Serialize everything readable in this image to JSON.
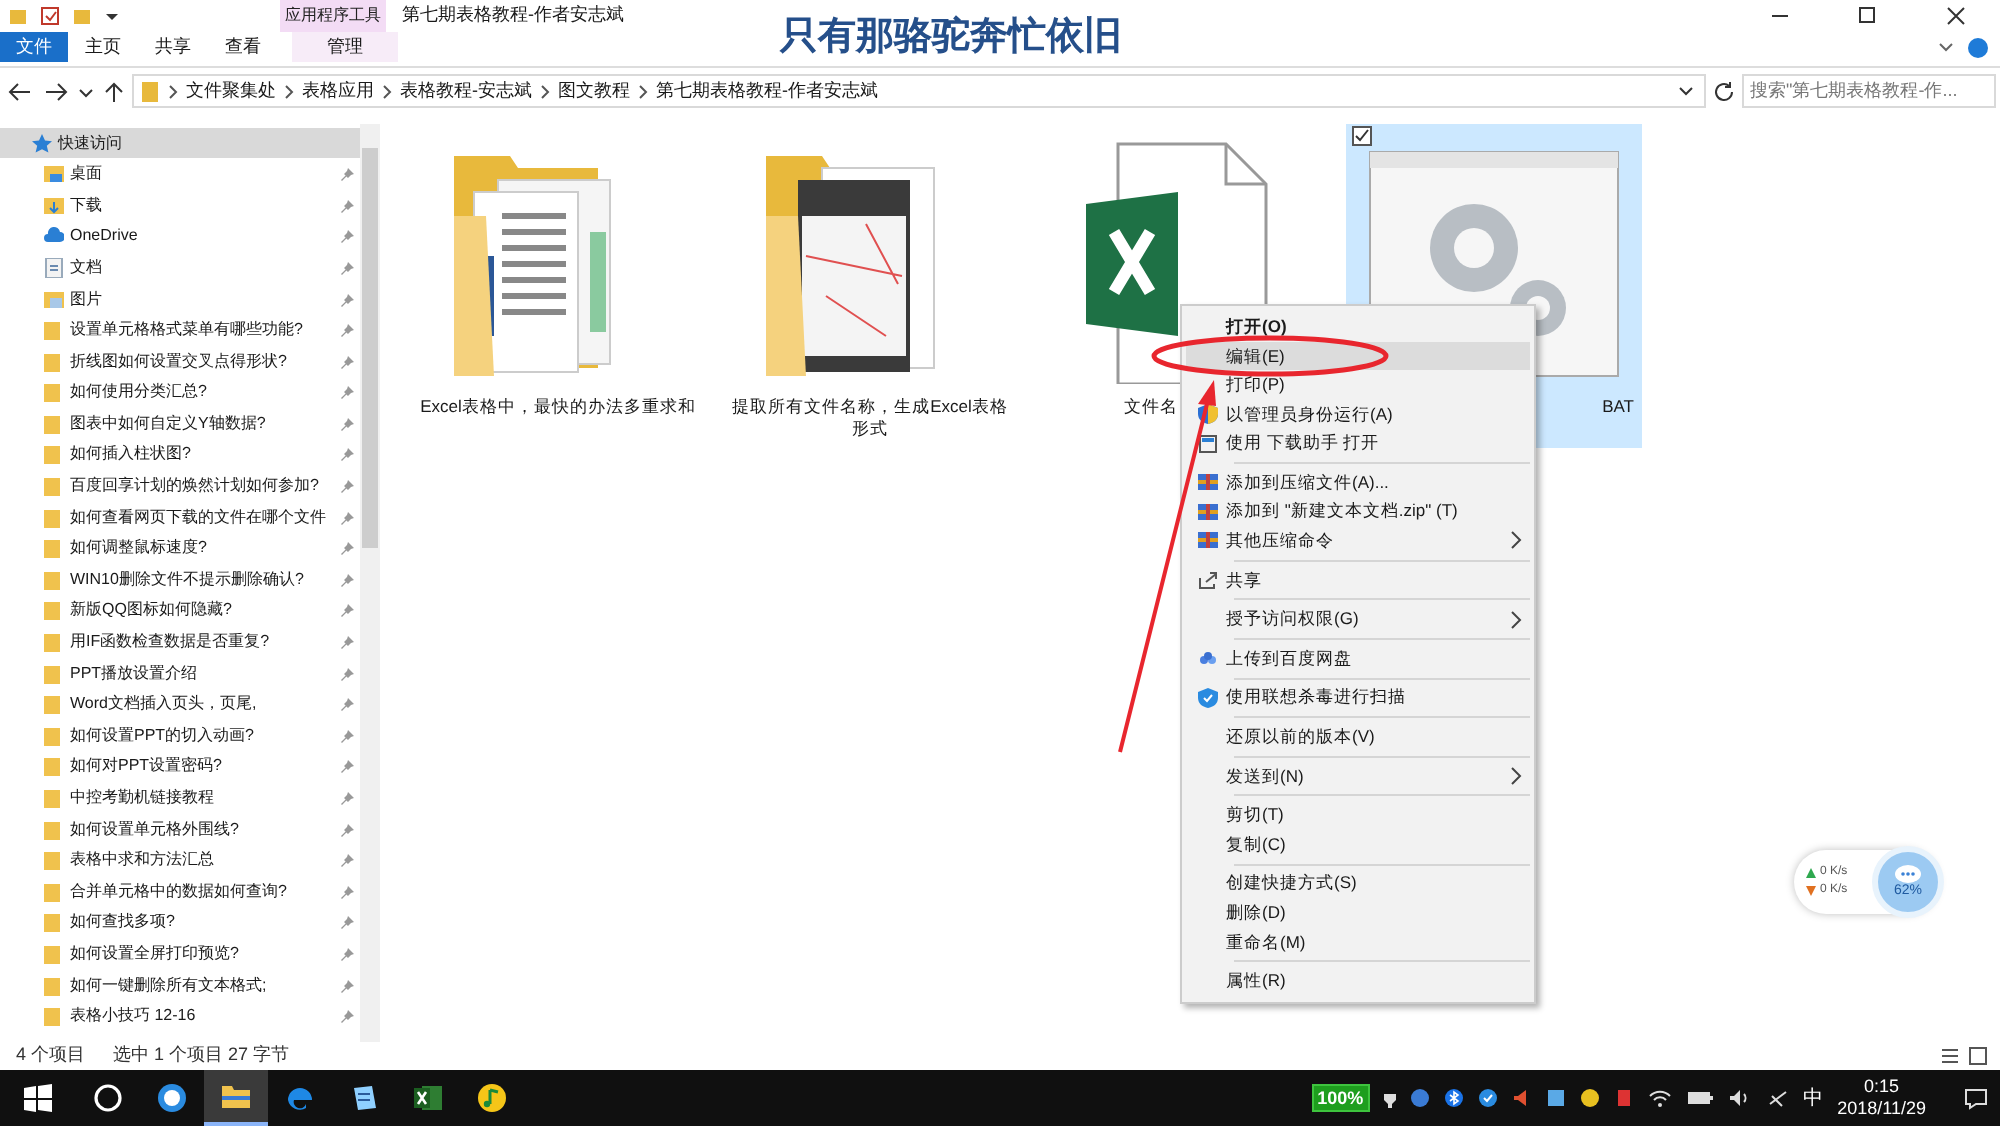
{
  "window": {
    "title": "第七期表格教程-作者安志斌",
    "context_tab_group": "应用程序工具"
  },
  "caption": "只有那骆驼奔忙依旧",
  "ribbon_tabs": [
    {
      "label": "文件",
      "kind": "file",
      "selected": false
    },
    {
      "label": "主页",
      "kind": "tab",
      "selected": false
    },
    {
      "label": "共享",
      "kind": "tab",
      "selected": false
    },
    {
      "label": "查看",
      "kind": "tab",
      "selected": false
    },
    {
      "label": "管理",
      "kind": "context",
      "selected": false
    }
  ],
  "address": {
    "segments": [
      "文件聚集处",
      "表格应用",
      "表格教程-安志斌",
      "图文教程",
      "第七期表格教程-作者安志斌"
    ]
  },
  "search": {
    "placeholder": "搜索\"第七期表格教程-作..."
  },
  "sidebar": {
    "items": [
      {
        "label": "快速访问",
        "pinned": false,
        "selected": true
      },
      {
        "label": "桌面",
        "pinned": true,
        "selected": false
      },
      {
        "label": "下载",
        "pinned": true,
        "selected": false
      },
      {
        "label": "OneDrive",
        "pinned": true,
        "selected": false
      },
      {
        "label": "文档",
        "pinned": true,
        "selected": false
      },
      {
        "label": "图片",
        "pinned": true,
        "selected": false
      },
      {
        "label": "设置单元格格式菜单有哪些功能?",
        "pinned": true,
        "selected": false
      },
      {
        "label": "折线图如何设置交叉点得形状?",
        "pinned": true,
        "selected": false
      },
      {
        "label": "如何使用分类汇总?",
        "pinned": true,
        "selected": false
      },
      {
        "label": "图表中如何自定义Y轴数据?",
        "pinned": true,
        "selected": false
      },
      {
        "label": "如何插入柱状图?",
        "pinned": true,
        "selected": false
      },
      {
        "label": "百度回享计划的焕然计划如何参加?",
        "pinned": true,
        "selected": false
      },
      {
        "label": "如何查看网页下载的文件在哪个文件",
        "pinned": true,
        "selected": false
      },
      {
        "label": "如何调整鼠标速度?",
        "pinned": true,
        "selected": false
      },
      {
        "label": "WIN10删除文件不提示删除确认?",
        "pinned": true,
        "selected": false
      },
      {
        "label": "新版QQ图标如何隐藏?",
        "pinned": true,
        "selected": false
      },
      {
        "label": "用IF函数检查数据是否重复?",
        "pinned": true,
        "selected": false
      },
      {
        "label": "PPT播放设置介绍",
        "pinned": true,
        "selected": false
      },
      {
        "label": "Word文档插入页头，页尾,",
        "pinned": true,
        "selected": false
      },
      {
        "label": "如何设置PPT的切入动画?",
        "pinned": true,
        "selected": false
      },
      {
        "label": "如何对PPT设置密码?",
        "pinned": true,
        "selected": false
      },
      {
        "label": "中控考勤机链接教程",
        "pinned": true,
        "selected": false
      },
      {
        "label": "如何设置单元格外围线?",
        "pinned": true,
        "selected": false
      },
      {
        "label": "表格中求和方法汇总",
        "pinned": true,
        "selected": false
      },
      {
        "label": "合并单元格中的数据如何查询?",
        "pinned": true,
        "selected": false
      },
      {
        "label": "如何查找多项?",
        "pinned": true,
        "selected": false
      },
      {
        "label": "如何设置全屏打印预览?",
        "pinned": true,
        "selected": false
      },
      {
        "label": "如何一键删除所有文本格式;",
        "pinned": true,
        "selected": false
      },
      {
        "label": "表格小技巧 12-16",
        "pinned": true,
        "selected": false
      }
    ]
  },
  "files": [
    {
      "name": "Excel表格中，最快的办法多重求和",
      "selected": false,
      "checked": false
    },
    {
      "name": "提取所有文件名称，生成Excel表格形式",
      "selected": false,
      "checked": false
    },
    {
      "name": "文件名",
      "selected": false,
      "checked": false
    },
    {
      "name": "BAT",
      "selected": true,
      "checked": true
    }
  ],
  "context_menu": {
    "items": [
      {
        "kind": "item",
        "label": "打开(O)",
        "bold": true,
        "selected": false,
        "submenu": false
      },
      {
        "kind": "item",
        "label": "编辑(E)",
        "bold": false,
        "selected": true,
        "submenu": false
      },
      {
        "kind": "item",
        "label": "打印(P)",
        "bold": false,
        "selected": false,
        "submenu": false
      },
      {
        "kind": "item",
        "label": "以管理员身份运行(A)",
        "bold": false,
        "selected": false,
        "submenu": false
      },
      {
        "kind": "item",
        "label": "使用 下载助手 打开",
        "bold": false,
        "selected": false,
        "submenu": false
      },
      {
        "kind": "separator"
      },
      {
        "kind": "item",
        "label": "添加到压缩文件(A)...",
        "bold": false,
        "selected": false,
        "submenu": false
      },
      {
        "kind": "item",
        "label": "添加到 \"新建文本文档.zip\" (T)",
        "bold": false,
        "selected": false,
        "submenu": false
      },
      {
        "kind": "item",
        "label": "其他压缩命令",
        "bold": false,
        "selected": false,
        "submenu": true
      },
      {
        "kind": "separator"
      },
      {
        "kind": "item",
        "label": "共享",
        "bold": false,
        "selected": false,
        "submenu": false
      },
      {
        "kind": "separator"
      },
      {
        "kind": "item",
        "label": "授予访问权限(G)",
        "bold": false,
        "selected": false,
        "submenu": true
      },
      {
        "kind": "separator"
      },
      {
        "kind": "item",
        "label": "上传到百度网盘",
        "bold": false,
        "selected": false,
        "submenu": false
      },
      {
        "kind": "separator"
      },
      {
        "kind": "item",
        "label": "使用联想杀毒进行扫描",
        "bold": false,
        "selected": false,
        "submenu": false
      },
      {
        "kind": "separator"
      },
      {
        "kind": "item",
        "label": "还原以前的版本(V)",
        "bold": false,
        "selected": false,
        "submenu": false
      },
      {
        "kind": "separator"
      },
      {
        "kind": "item",
        "label": "发送到(N)",
        "bold": false,
        "selected": false,
        "submenu": true
      },
      {
        "kind": "separator"
      },
      {
        "kind": "item",
        "label": "剪切(T)",
        "bold": false,
        "selected": false,
        "submenu": false
      },
      {
        "kind": "item",
        "label": "复制(C)",
        "bold": false,
        "selected": false,
        "submenu": false
      },
      {
        "kind": "separator"
      },
      {
        "kind": "item",
        "label": "创建快捷方式(S)",
        "bold": false,
        "selected": false,
        "submenu": false
      },
      {
        "kind": "item",
        "label": "删除(D)",
        "bold": false,
        "selected": false,
        "submenu": false
      },
      {
        "kind": "item",
        "label": "重命名(M)",
        "bold": false,
        "selected": false,
        "submenu": false
      },
      {
        "kind": "separator"
      },
      {
        "kind": "item",
        "label": "属性(R)",
        "bold": false,
        "selected": false,
        "submenu": false
      }
    ]
  },
  "status_bar": {
    "item_count": "4 个项目",
    "selection": "选中 1 个项目  27 字节"
  },
  "speed_widget": {
    "upload": "0  K/s",
    "download": "0  K/s",
    "percent": "62%"
  },
  "taskbar": {
    "apps": [
      {
        "active": false
      },
      {
        "active": false
      },
      {
        "active": true
      },
      {
        "active": false
      },
      {
        "active": false
      },
      {
        "active": false
      },
      {
        "active": false
      }
    ],
    "battery": "100%",
    "ime": "中",
    "time": "0:15",
    "date": "2018/11/29"
  }
}
